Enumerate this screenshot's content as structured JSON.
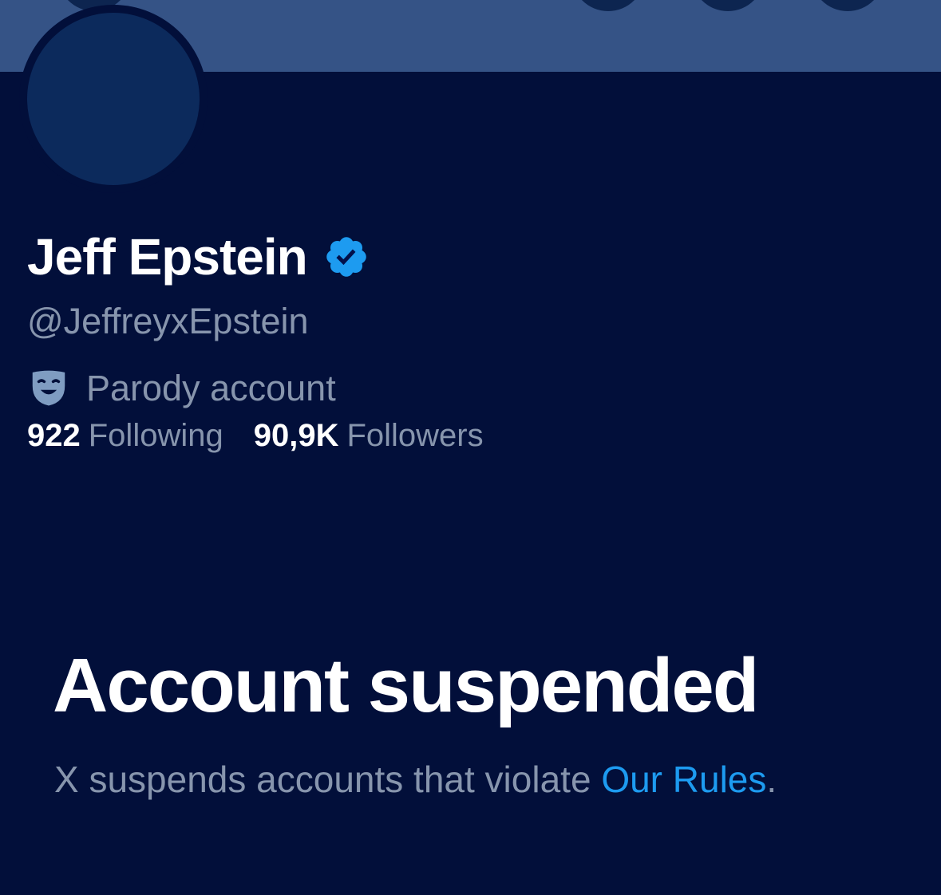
{
  "profile": {
    "display_name": "Jeff Epstein",
    "handle": "@JeffreyxEpstein",
    "parody_label": "Parody account",
    "verified_icon": "verified-badge-icon",
    "parody_icon": "theater-mask-icon"
  },
  "stats": {
    "following_count": "922",
    "following_label": "Following",
    "followers_count": "90,9K",
    "followers_label": "Followers"
  },
  "suspension": {
    "title": "Account suspended",
    "message": "X suspends accounts that violate ",
    "rules_link": "Our Rules",
    "period": "."
  },
  "colors": {
    "background": "#020f3a",
    "banner": "#355386",
    "verified": "#1d9bf0",
    "link": "#1d9bf0",
    "secondary_text": "#8795ad"
  }
}
